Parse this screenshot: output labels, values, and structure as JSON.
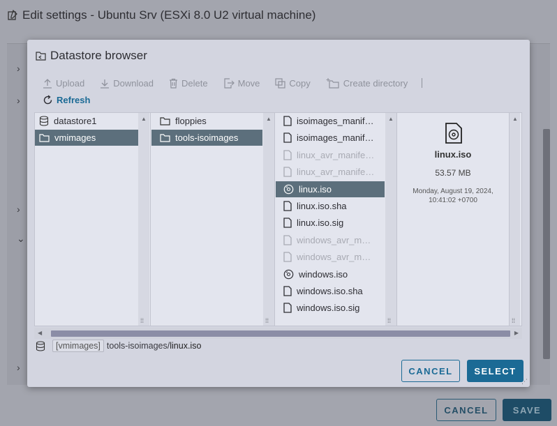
{
  "background": {
    "title": "Edit settings - Ubuntu Srv (ESXi 8.0 U2 virtual machine)",
    "cancel_label": "CANCEL",
    "save_label": "SAVE"
  },
  "modal": {
    "title": "Datastore browser",
    "toolbar": {
      "upload": "Upload",
      "download": "Download",
      "delete": "Delete",
      "move": "Move",
      "copy": "Copy",
      "create_directory": "Create directory",
      "refresh": "Refresh"
    },
    "columns": {
      "datastores": [
        {
          "label": "datastore1",
          "icon": "datastore-icon",
          "selected": false
        },
        {
          "label": "vmimages",
          "icon": "folder-icon",
          "selected": true
        }
      ],
      "folders": [
        {
          "label": "floppies",
          "icon": "folder-icon",
          "selected": false
        },
        {
          "label": "tools-isoimages",
          "icon": "folder-icon",
          "selected": true
        }
      ],
      "files": [
        {
          "label": "isoimages_manif…",
          "icon": "file-icon",
          "state": "normal"
        },
        {
          "label": "isoimages_manif…",
          "icon": "file-icon",
          "state": "normal"
        },
        {
          "label": "linux_avr_manife…",
          "icon": "file-icon",
          "state": "dim"
        },
        {
          "label": "linux_avr_manife…",
          "icon": "file-icon",
          "state": "dim"
        },
        {
          "label": "linux.iso",
          "icon": "disc-icon",
          "state": "selected"
        },
        {
          "label": "linux.iso.sha",
          "icon": "file-icon",
          "state": "normal"
        },
        {
          "label": "linux.iso.sig",
          "icon": "file-icon",
          "state": "normal"
        },
        {
          "label": "windows_avr_m…",
          "icon": "file-icon",
          "state": "dim"
        },
        {
          "label": "windows_avr_m…",
          "icon": "file-icon",
          "state": "dim"
        },
        {
          "label": "windows.iso",
          "icon": "disc-icon",
          "state": "normal"
        },
        {
          "label": "windows.iso.sha",
          "icon": "file-icon",
          "state": "normal"
        },
        {
          "label": "windows.iso.sig",
          "icon": "file-icon",
          "state": "normal"
        }
      ]
    },
    "preview": {
      "name": "linux.iso",
      "size": "53.57 MB",
      "date_line1": "Monday, August 19, 2024,",
      "date_line2": "10:41:02 +0700"
    },
    "path": {
      "datastore": "[vmimages]",
      "folder": "tools-isoimages/",
      "file": "linux.iso"
    },
    "cancel_label": "CANCEL",
    "select_label": "SELECT"
  },
  "colors": {
    "accent": "#1b6a95",
    "selection": "#5c6f7c",
    "modal_bg": "#d3d5e0"
  }
}
